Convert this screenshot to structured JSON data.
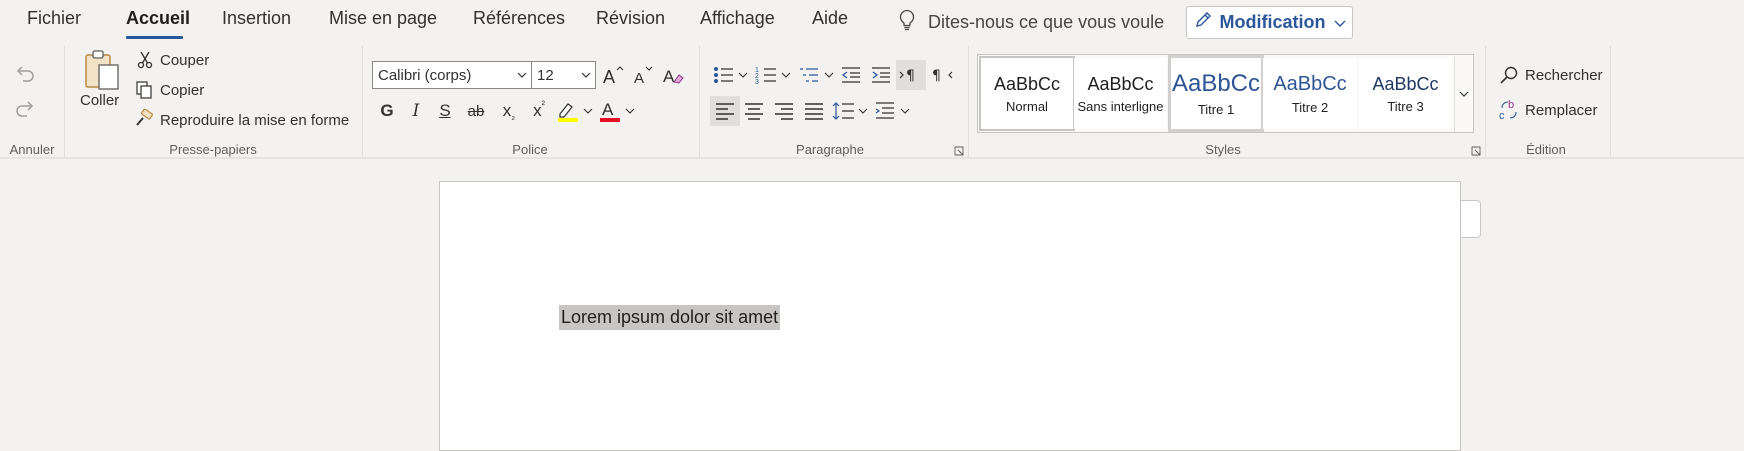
{
  "menu": {
    "items": [
      {
        "label": "Fichier"
      },
      {
        "label": "Accueil",
        "active": true
      },
      {
        "label": "Insertion"
      },
      {
        "label": "Mise en page"
      },
      {
        "label": "Références"
      },
      {
        "label": "Révision"
      },
      {
        "label": "Affichage"
      },
      {
        "label": "Aide"
      }
    ],
    "tell_me": "Dites-nous ce que vous voule",
    "edit_mode": "Modification"
  },
  "ribbon": {
    "undo_group": {
      "label": "Annuler",
      "undo_icon": "undo-icon",
      "redo_icon": "redo-icon"
    },
    "clipboard": {
      "label": "Presse-papiers",
      "paste": "Coller",
      "cut": "Couper",
      "copy": "Copier",
      "format_painter": "Reproduire la mise en forme"
    },
    "font": {
      "label": "Police",
      "font_name": "Calibri (corps)",
      "font_size": "12",
      "bold": "G",
      "italic": "I",
      "underline": "S",
      "strike": "ab",
      "subscript": "x",
      "superscript": "x",
      "highlight_color": "#ffff00",
      "font_color": "#e81123"
    },
    "paragraph": {
      "label": "Paragraphe"
    },
    "styles": {
      "label": "Styles",
      "items": [
        {
          "sample": "AaBbCc",
          "name": "Normal"
        },
        {
          "sample": "AaBbCc",
          "name": "Sans interligne"
        },
        {
          "sample": "AaBbCc",
          "name": "Titre 1"
        },
        {
          "sample": "AaBbCc",
          "name": "Titre 2"
        },
        {
          "sample": "AaBbCc",
          "name": "Titre 3"
        }
      ]
    },
    "editing": {
      "label": "Édition",
      "find": "Rechercher",
      "replace": "Remplacer"
    }
  },
  "document": {
    "text": "Lorem ipsum dolor sit amet"
  },
  "colors": {
    "accent": "#2b579a",
    "selection": "#c8c6c4"
  }
}
